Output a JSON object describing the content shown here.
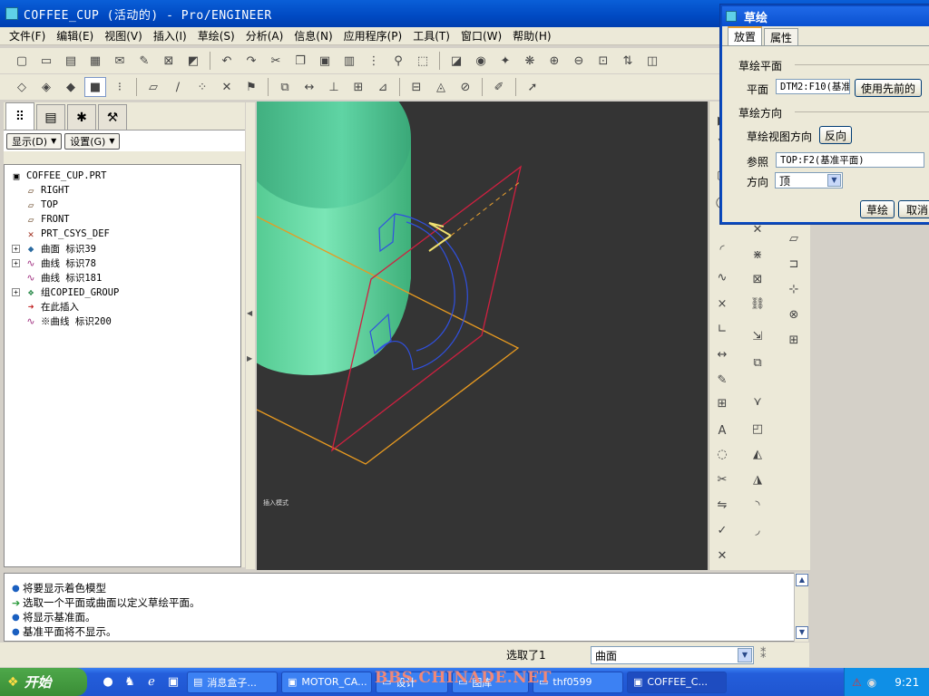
{
  "window": {
    "title": "COFFEE_CUP (活动的) - Pro/ENGINEER"
  },
  "menu": [
    "文件(F)",
    "编辑(E)",
    "视图(V)",
    "插入(I)",
    "草绘(S)",
    "分析(A)",
    "信息(N)",
    "应用程序(P)",
    "工具(T)",
    "窗口(W)",
    "帮助(H)"
  ],
  "left_panel": {
    "show_button": "显示(D)",
    "settings_button": "设置(G)",
    "tree": [
      {
        "label": "COFFEE_CUP.PRT",
        "icon": "part-icon",
        "glyph": "▣",
        "expandable": false
      },
      {
        "label": "RIGHT",
        "icon": "datum-plane-icon",
        "glyph": "▱",
        "expandable": false
      },
      {
        "label": "TOP",
        "icon": "datum-plane-icon",
        "glyph": "▱",
        "expandable": false
      },
      {
        "label": "FRONT",
        "icon": "datum-plane-icon",
        "glyph": "▱",
        "expandable": false
      },
      {
        "label": "PRT_CSYS_DEF",
        "icon": "csys-icon",
        "glyph": "✕",
        "expandable": false
      },
      {
        "label": "曲面 标识39",
        "icon": "surface-icon",
        "glyph": "◆",
        "expandable": true
      },
      {
        "label": "曲线 标识78",
        "icon": "curve-icon",
        "glyph": "∿",
        "expandable": true
      },
      {
        "label": "曲线 标识181",
        "icon": "curve-icon",
        "glyph": "∿",
        "expandable": false
      },
      {
        "label": "组COPIED_GROUP",
        "icon": "group-icon",
        "glyph": "❖",
        "expandable": true
      },
      {
        "label": "在此插入",
        "icon": "insert-here-icon",
        "glyph": "➜",
        "expandable": false
      },
      {
        "label": "※曲线 标识200",
        "icon": "curve-icon",
        "glyph": "∿",
        "expandable": false
      }
    ]
  },
  "viewport": {
    "mode_label": "插入模式"
  },
  "messages": [
    {
      "type": "info",
      "text": "将要显示着色模型"
    },
    {
      "type": "prompt",
      "text": "选取一个平面或曲面以定义草绘平面。"
    },
    {
      "type": "info",
      "text": "将显示基准面。"
    },
    {
      "type": "info",
      "text": "基准平面将不显示。"
    }
  ],
  "status": {
    "selection_text": "选取了1",
    "filter_value": "曲面"
  },
  "dialog": {
    "title": "草绘",
    "tabs": [
      "放置",
      "属性"
    ],
    "sketch_plane_section": "草绘平面",
    "plane_label": "平面",
    "plane_value": "DTM2:F10(基准",
    "use_previous_button": "使用先前的",
    "orientation_section": "草绘方向",
    "view_direction_label": "草绘视图方向",
    "flip_button": "反向",
    "reference_label": "参照",
    "reference_value": "TOP:F2(基准平面)",
    "orientation_label": "方向",
    "orientation_value": "顶",
    "sketch_button": "草绘",
    "cancel_button": "取消"
  },
  "taskbar": {
    "start_label": "开始",
    "tasks": [
      "消息盒子...",
      "MOTOR_CA...",
      "设计",
      "图库",
      "thf0599",
      "COFFEE_C..."
    ],
    "watermark": "BBS.CHINADE.NET",
    "clock": "9:21"
  },
  "colors": {
    "cup": "#5fd4a4",
    "viewport_bg": "#343434",
    "title_bar": "#0a5fd8",
    "plane_red": "#d02040",
    "plane_orange": "#e89a20",
    "curve_blue": "#3050e0"
  }
}
